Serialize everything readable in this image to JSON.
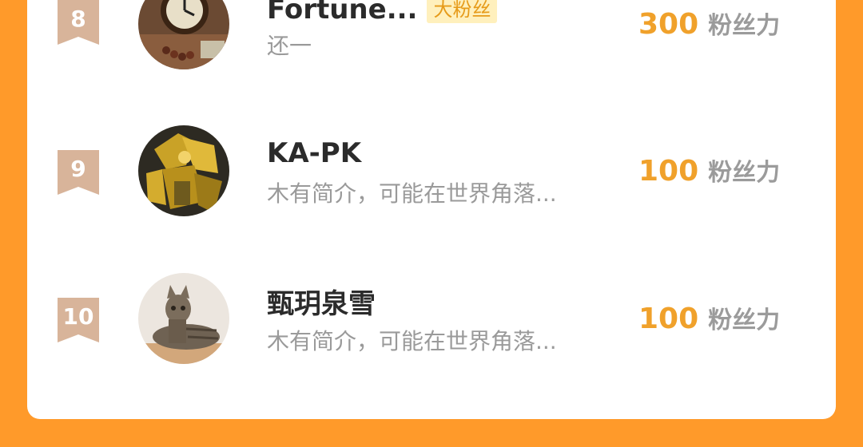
{
  "ranking": {
    "rows": [
      {
        "rank": "8",
        "name": "Fortune...",
        "badge": "大粉丝",
        "bio": "还一",
        "score": "300",
        "score_unit": "粉丝力"
      },
      {
        "rank": "9",
        "name": "KA-PK",
        "bio": "木有简介，可能在世界角落...",
        "score": "100",
        "score_unit": "粉丝力"
      },
      {
        "rank": "10",
        "name": "甄玥泉雪",
        "bio": "木有简介，可能在世界角落...",
        "score": "100",
        "score_unit": "粉丝力"
      }
    ]
  },
  "colors": {
    "page_background": "#ff9a2a",
    "score_color": "#f0a12b",
    "badge_bg": "#fff0bd",
    "rank_badge": "#d8b49a"
  }
}
